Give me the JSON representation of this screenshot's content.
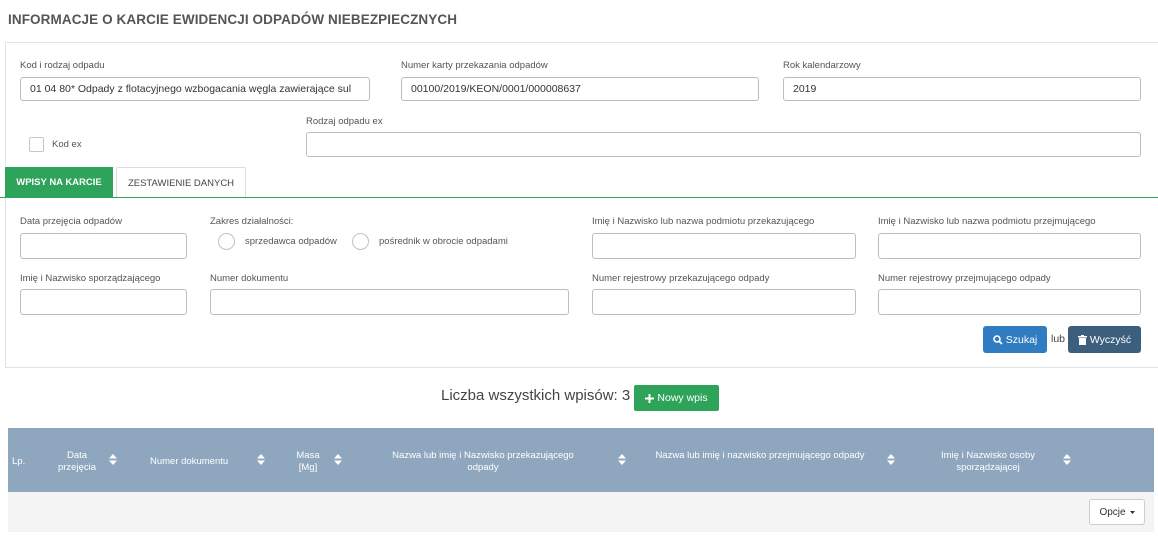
{
  "page": {
    "title": "INFORMACJE O KARCIE EWIDENCJI ODPADÓW NIEBEZPIECZNYCH"
  },
  "card": {
    "waste_code_label": "Kod i rodzaj odpadu",
    "waste_code_value": "01 04 80* Odpady z flotacyjnego wzbogacania węgla zawierające sul",
    "card_number_label": "Numer karty przekazania odpadów",
    "card_number_value": "00100/2019/KEON/0001/000008637",
    "year_label": "Rok kalendarzowy",
    "year_value": "2019",
    "kod_ex_label": "Kod ex",
    "waste_type_ex_label": "Rodzaj odpadu ex",
    "waste_type_ex_value": ""
  },
  "tabs": [
    {
      "label": "WPISY NA KARCIE",
      "active": true
    },
    {
      "label": "ZESTAWIENIE DANYCH",
      "active": false
    }
  ],
  "filters": {
    "date_label": "Data przejęcia odpadów",
    "scope_label": "Zakres działalności:",
    "scope_options": [
      "sprzedawca odpadów",
      "pośrednik w obrocie odpadami"
    ],
    "transferor_label": "Imię i Nazwisko lub nazwa podmiotu przekazującego",
    "receiver_label": "Imię i Nazwisko lub nazwa podmiotu przejmującego",
    "preparer_label": "Imię i Nazwisko sporządzającego",
    "doc_number_label": "Numer dokumentu",
    "transferor_reg_label": "Numer rejestrowy przekazującego odpady",
    "receiver_reg_label": "Numer rejestrowy przejmującego odpady",
    "search_label": "Szukaj",
    "or_label": "lub",
    "clear_label": "Wyczyść"
  },
  "entries": {
    "count_label": "Liczba wszystkich wpisów: 3",
    "new_label": "Nowy wpis"
  },
  "table": {
    "columns": [
      "Lp.",
      "Data przejęcia",
      "Numer dokumentu",
      "Masa [Mg]",
      "Nazwa lub imię i Nazwisko przekazującego odpady",
      "Nazwa lub imię i nazwisko przejmującego odpady",
      "Imię i Nazwisko osoby sporządzającej"
    ],
    "options_label": "Opcje"
  },
  "colors": {
    "accent_green": "#2ea35a",
    "search_blue": "#2f7dc0",
    "clear_navy": "#3d5f7e",
    "table_header": "#8fa6bf"
  }
}
